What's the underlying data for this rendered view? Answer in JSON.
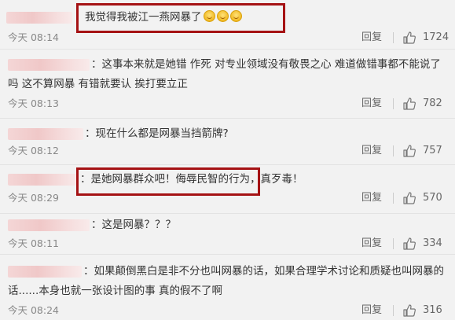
{
  "comments": [
    {
      "line1": "我觉得我被江一燕网暴了",
      "line2": "",
      "time": "今天 08:14",
      "reply": "回复",
      "likes": "1724",
      "emoji_count": 3,
      "has_username": false
    },
    {
      "line1": "：这事本来就是她错 作死 对专业领域没有敬畏之心 难道做错事都不能说了",
      "line2": "吗 这不算网暴 有错就要认 挨打要立正",
      "time": "今天 08:13",
      "reply": "回复",
      "likes": "782",
      "has_username": true
    },
    {
      "line1": "：现在什么都是网暴当挡箭牌?",
      "line2": "",
      "time": "今天 08:12",
      "reply": "回复",
      "likes": "757",
      "has_username": true
    },
    {
      "line1": "：是她网暴群众吧！侮辱民智的行为，真歹毒！",
      "line2": "",
      "time": "今天 08:29",
      "reply": "回复",
      "likes": "570",
      "has_username": true
    },
    {
      "line1": "：这是网暴？？？",
      "line2": "",
      "time": "今天 08:11",
      "reply": "回复",
      "likes": "334",
      "has_username": true
    },
    {
      "line1": "：如果颠倒黑白是非不分也叫网暴的话，如果合理学术讨论和质疑也叫网暴的",
      "line2": "话......本身也就一张设计图的事 真的假不了啊",
      "time": "今天 08:24",
      "reply": "回复",
      "likes": "316",
      "has_username": true
    }
  ],
  "icons": {
    "like": "thumbs-up-icon",
    "emoji": "smile-emoji-icon"
  },
  "colors": {
    "highlight": "#a51214",
    "background": "#f2f2f2",
    "meta_text": "#888888"
  }
}
